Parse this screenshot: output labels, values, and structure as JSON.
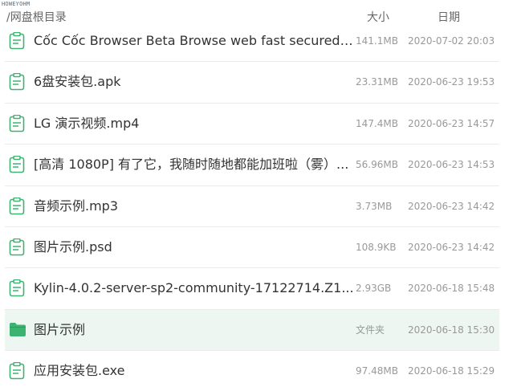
{
  "watermark": "HOWEYOHM",
  "header": {
    "path": "/网盘根目录",
    "size_label": "大小",
    "date_label": "日期"
  },
  "colors": {
    "accent": "#3cb371",
    "selected_row_bg": "#edf6f1",
    "divider": "#ebebeb"
  },
  "files": [
    {
      "name": "Cốc Cốc Browser Beta Browse web fast secured_v...",
      "size": "141.1MB",
      "date": "2020-07-02 20:03",
      "icon": "file-icon"
    },
    {
      "name": "6盘安装包.apk",
      "size": "23.31MB",
      "date": "2020-06-23 19:53",
      "icon": "file-icon"
    },
    {
      "name": "LG 演示视频.mp4",
      "size": "147.4MB",
      "date": "2020-06-23 14:57",
      "icon": "file-icon"
    },
    {
      "name": "[高清 1080P] 有了它，我随时随地都能加班啦（雾）...",
      "size": "56.96MB",
      "date": "2020-06-23 14:53",
      "icon": "file-icon"
    },
    {
      "name": "音频示例.mp3",
      "size": "3.73MB",
      "date": "2020-06-23 14:42",
      "icon": "file-icon"
    },
    {
      "name": "图片示例.psd",
      "size": "108.9KB",
      "date": "2020-06-23 14:42",
      "icon": "file-icon"
    },
    {
      "name": "Kylin-4.0.2-server-sp2-community-17122714.Z1...",
      "size": "2.93GB",
      "date": "2020-06-18 15:48",
      "icon": "file-icon"
    },
    {
      "name": "图片示例",
      "size": "文件夹",
      "date": "2020-06-18 15:30",
      "icon": "folder-icon",
      "selected": true
    },
    {
      "name": "应用安装包.exe",
      "size": "97.48MB",
      "date": "2020-06-18 15:29",
      "icon": "file-icon"
    }
  ]
}
